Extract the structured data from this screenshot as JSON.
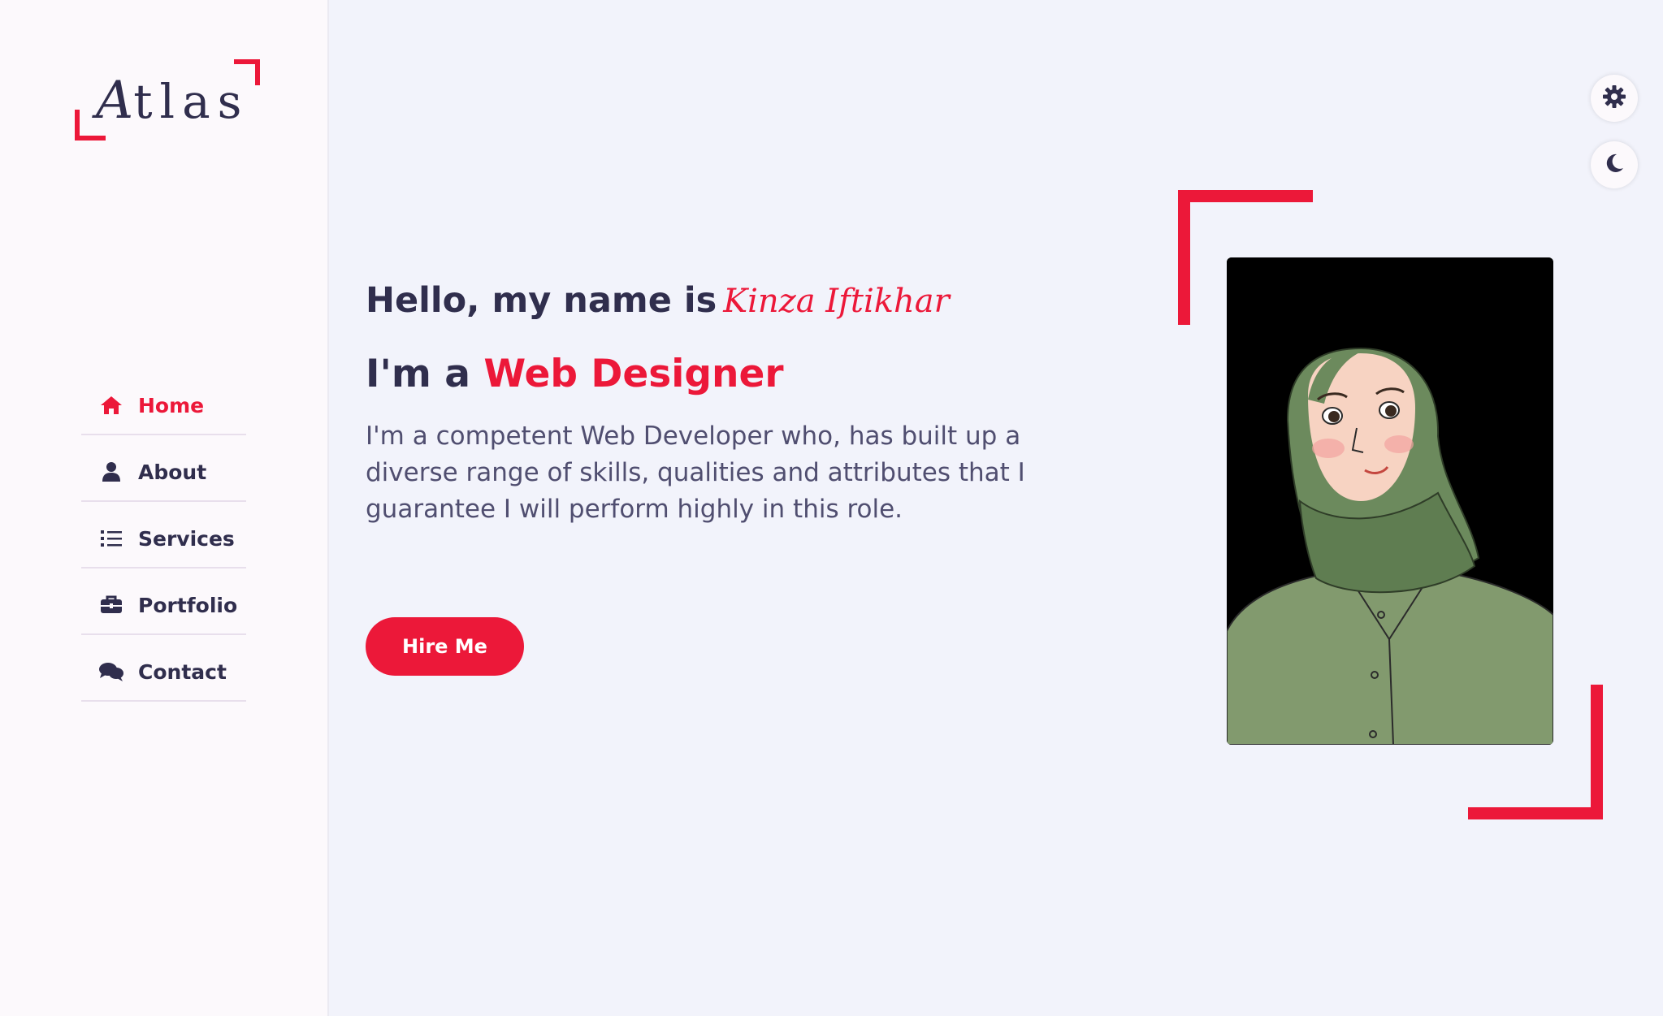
{
  "brand": {
    "logo_initial": "A",
    "logo_rest": "tlas"
  },
  "sidebar": {
    "items": [
      {
        "label": "Home",
        "icon": "home-icon",
        "active": true
      },
      {
        "label": "About",
        "icon": "user-icon",
        "active": false
      },
      {
        "label": "Services",
        "icon": "list-icon",
        "active": false
      },
      {
        "label": "Portfolio",
        "icon": "briefcase-icon",
        "active": false
      },
      {
        "label": "Contact",
        "icon": "comments-icon",
        "active": false
      }
    ]
  },
  "hero": {
    "greeting": "Hello, my name is",
    "name": "Kinza Iftikhar",
    "role_prefix": "I'm a",
    "role": "Web Designer",
    "description": "I'm a competent Web Developer who, has built up a diverse range of skills, qualities and attributes that I guarantee I will perform highly in this role.",
    "cta": "Hire Me"
  },
  "toolbar": {
    "settings_icon": "gear-icon",
    "theme_icon": "moon-icon"
  },
  "colors": {
    "accent": "#ec1839",
    "text_dark": "#302e4d",
    "text_body": "#504e70",
    "background": "#f2f3fb",
    "sidebar_bg": "#fcf9fc"
  }
}
